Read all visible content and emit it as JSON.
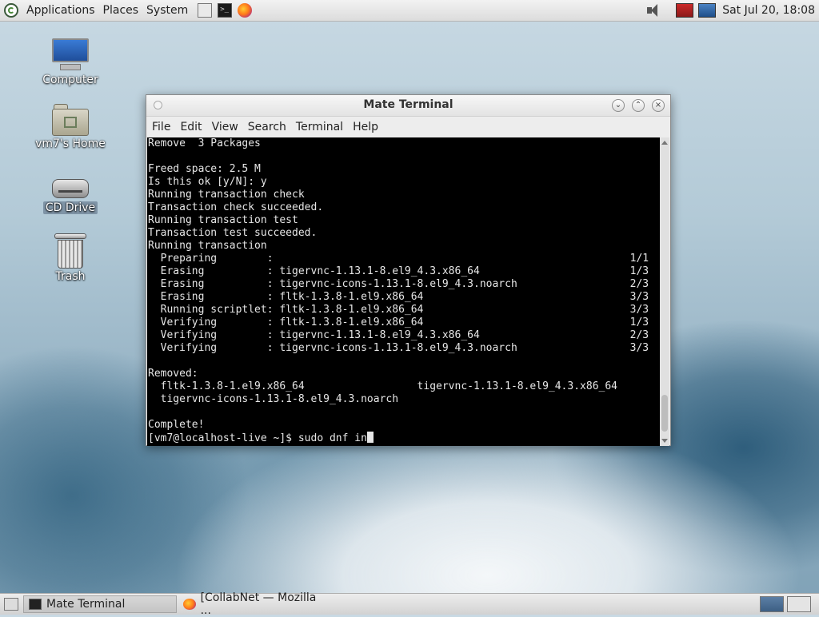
{
  "top_panel": {
    "menus": [
      "Applications",
      "Places",
      "System"
    ],
    "clock": "Sat Jul 20, 18:08"
  },
  "desktop_icons": [
    {
      "label": "Computer",
      "icon": "computer-icon"
    },
    {
      "label": "vm7's Home",
      "icon": "home-folder-icon"
    },
    {
      "label": "CD Drive",
      "icon": "cd-drive-icon"
    },
    {
      "label": "Trash",
      "icon": "trash-icon"
    }
  ],
  "terminal": {
    "title": "Mate Terminal",
    "menu": [
      "File",
      "Edit",
      "View",
      "Search",
      "Terminal",
      "Help"
    ],
    "lines": [
      "Remove  3 Packages",
      "",
      "Freed space: 2.5 M",
      "Is this ok [y/N]: y",
      "Running transaction check",
      "Transaction check succeeded.",
      "Running transaction test",
      "Transaction test succeeded.",
      "Running transaction",
      "  Preparing        :                                                         1/1",
      "  Erasing          : tigervnc-1.13.1-8.el9_4.3.x86_64                        1/3",
      "  Erasing          : tigervnc-icons-1.13.1-8.el9_4.3.noarch                  2/3",
      "  Erasing          : fltk-1.3.8-1.el9.x86_64                                 3/3",
      "  Running scriptlet: fltk-1.3.8-1.el9.x86_64                                 3/3",
      "  Verifying        : fltk-1.3.8-1.el9.x86_64                                 1/3",
      "  Verifying        : tigervnc-1.13.1-8.el9_4.3.x86_64                        2/3",
      "  Verifying        : tigervnc-icons-1.13.1-8.el9_4.3.noarch                  3/3",
      "",
      "Removed:",
      "  fltk-1.3.8-1.el9.x86_64                  tigervnc-1.13.1-8.el9_4.3.x86_64",
      "  tigervnc-icons-1.13.1-8.el9_4.3.noarch",
      "",
      "Complete!"
    ],
    "prompt": "[vm7@localhost-live ~]$ sudo dnf in"
  },
  "taskbar": {
    "tasks": [
      {
        "label": "Mate Terminal",
        "icon": "terminal-icon",
        "active": true
      },
      {
        "label": "[CollabNet — Mozilla ...",
        "icon": "firefox-icon",
        "active": false
      }
    ]
  }
}
